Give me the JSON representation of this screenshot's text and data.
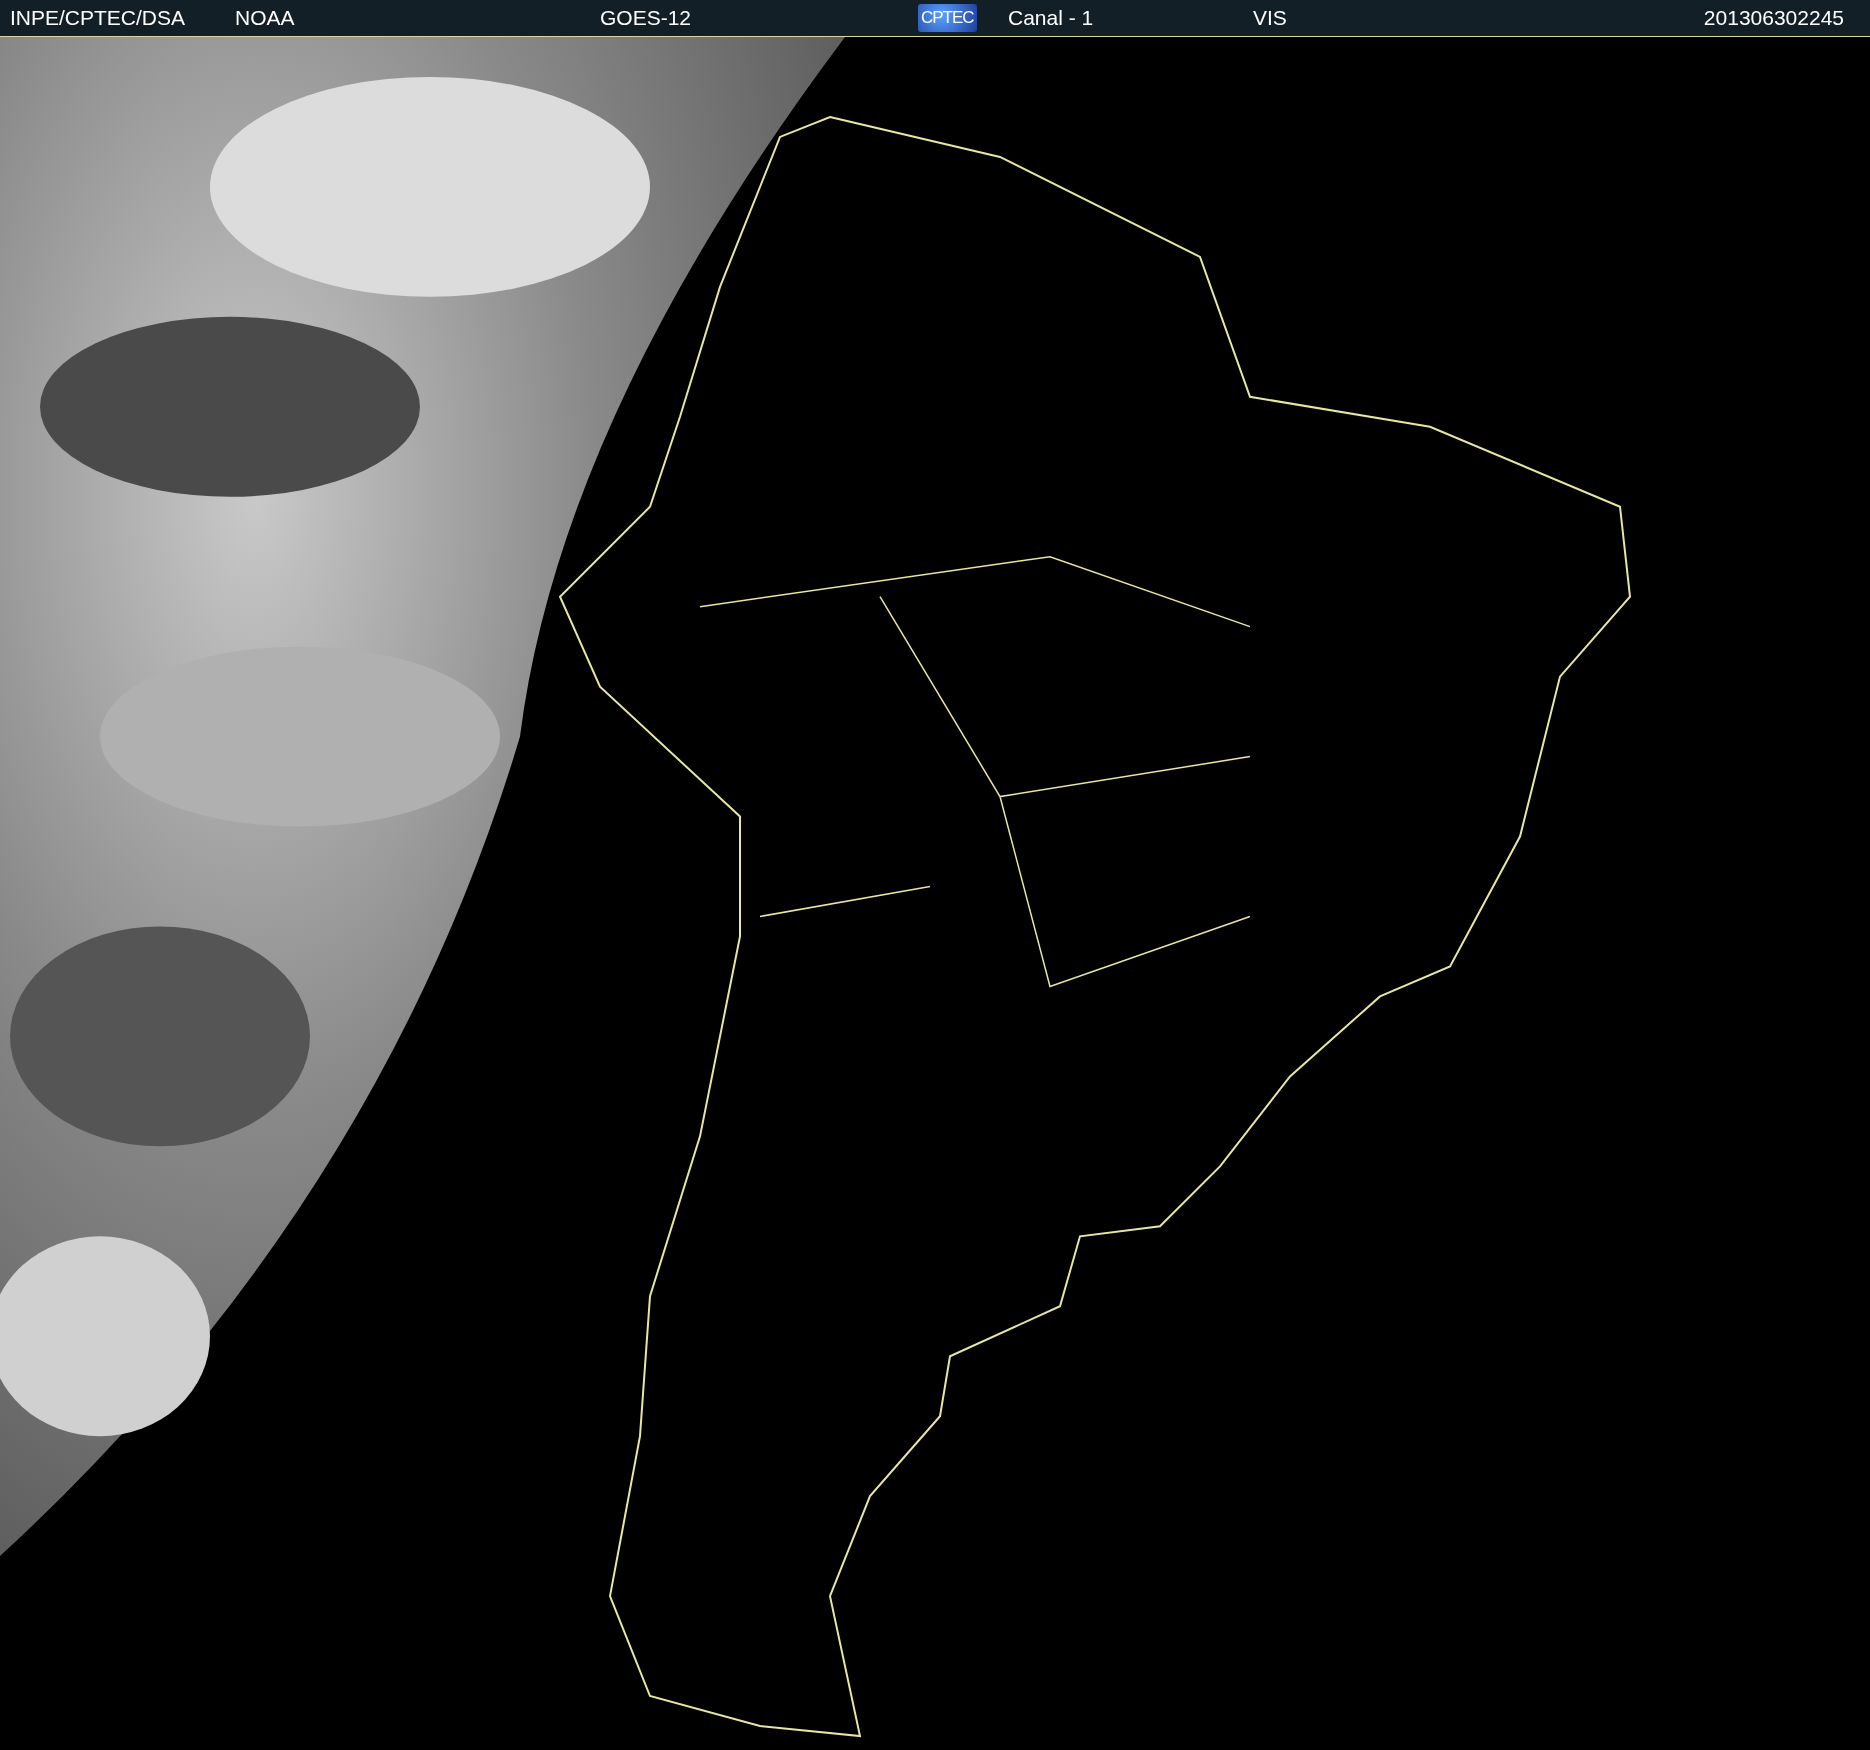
{
  "header": {
    "agency": "INPE/CPTEC/DSA",
    "source": "NOAA",
    "satellite": "GOES-12",
    "logo": "CPTEC",
    "channel": "Canal - 1",
    "band": "VIS",
    "timestamp": "201306302245"
  }
}
